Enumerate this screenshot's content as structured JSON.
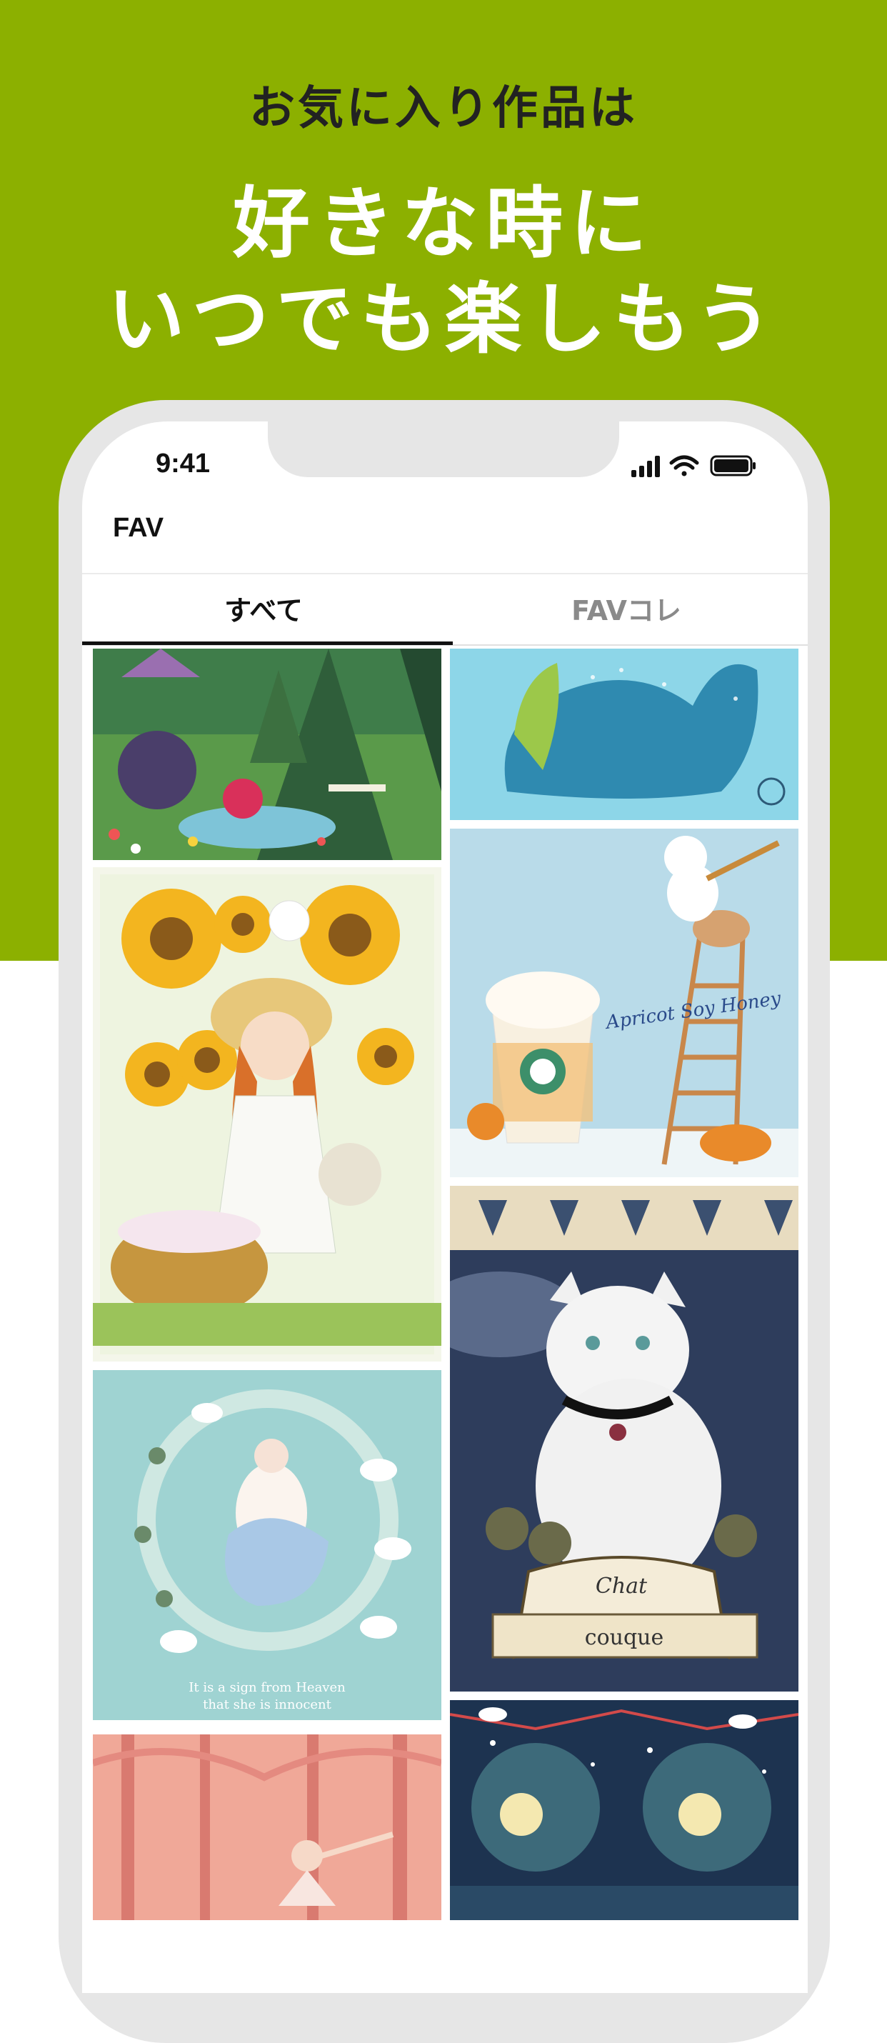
{
  "promo": {
    "line1": "お気に入り作品は",
    "line2": "好きな時に",
    "line3": "いつでも楽しもう",
    "background_color": "#8cb000"
  },
  "status_bar": {
    "time": "9:41",
    "icons": [
      "cellular-signal-icon",
      "wifi-icon",
      "battery-icon"
    ]
  },
  "app": {
    "title": "FAV"
  },
  "tabs": [
    {
      "label": "すべて",
      "active": true
    },
    {
      "label": "FAVコレ",
      "active": false
    }
  ],
  "artworks": {
    "left": [
      {
        "name": "forest-characters-artwork"
      },
      {
        "name": "sunflower-girl-artwork"
      },
      {
        "name": "ballerina-swans-artwork",
        "caption_line1": "It is a sign from Heaven",
        "caption_line2": "that she is innocent"
      },
      {
        "name": "pink-forest-dancer-artwork"
      }
    ],
    "right": [
      {
        "name": "blue-dinosaur-artwork"
      },
      {
        "name": "apricot-drink-polar-bear-artwork",
        "caption": "Apricot Soy Honey"
      },
      {
        "name": "white-cat-artwork",
        "caption_top": "Chat",
        "caption_bottom": "couque"
      },
      {
        "name": "night-forest-artwork"
      }
    ]
  }
}
